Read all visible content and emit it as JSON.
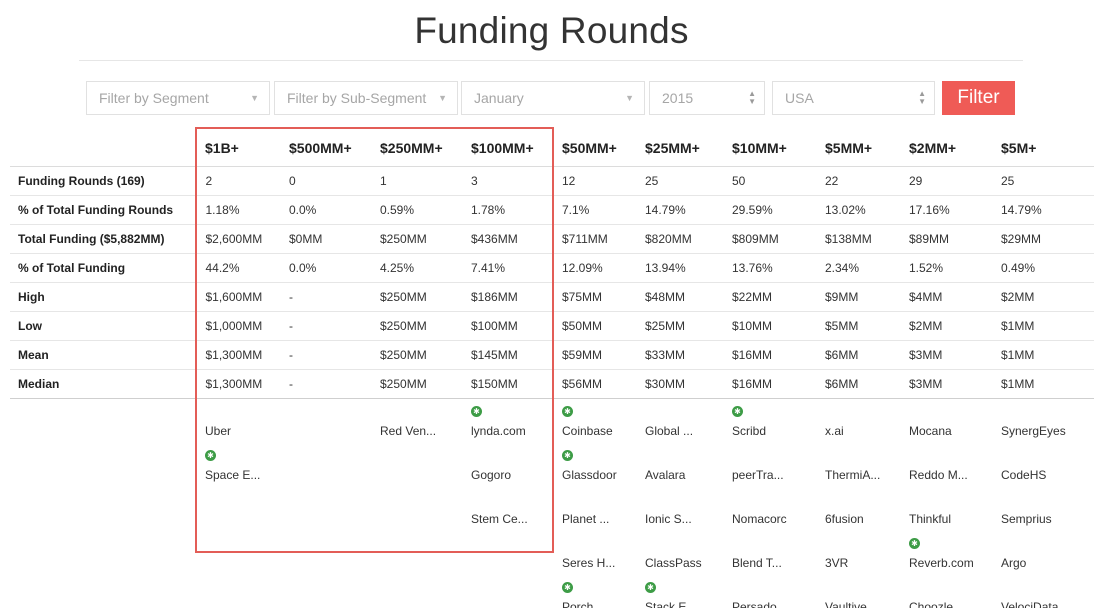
{
  "page": {
    "title": "Funding Rounds"
  },
  "filters": {
    "segment_placeholder": "Filter by Segment",
    "subsegment_placeholder": "Filter by Sub-Segment",
    "month_value": "January",
    "year_value": "2015",
    "country_value": "USA",
    "button_label": "Filter",
    "button_color": "#ef5b56"
  },
  "highlight_color": "#e35d57",
  "table": {
    "columns": [
      "$1B+",
      "$500MM+",
      "$250MM+",
      "$100MM+",
      "$50MM+",
      "$25MM+",
      "$10MM+",
      "$5MM+",
      "$2MM+",
      "$5M+"
    ],
    "rows": [
      {
        "label": "Funding Rounds (169)",
        "values": [
          "2",
          "0",
          "1",
          "3",
          "12",
          "25",
          "50",
          "22",
          "29",
          "25"
        ]
      },
      {
        "label": "% of Total Funding Rounds",
        "values": [
          "1.18%",
          "0.0%",
          "0.59%",
          "1.78%",
          "7.1%",
          "14.79%",
          "29.59%",
          "13.02%",
          "17.16%",
          "14.79%"
        ]
      },
      {
        "label": "Total Funding ($5,882MM)",
        "values": [
          "$2,600MM",
          "$0MM",
          "$250MM",
          "$436MM",
          "$711MM",
          "$820MM",
          "$809MM",
          "$138MM",
          "$89MM",
          "$29MM"
        ]
      },
      {
        "label": "% of Total Funding",
        "values": [
          "44.2%",
          "0.0%",
          "4.25%",
          "7.41%",
          "12.09%",
          "13.94%",
          "13.76%",
          "2.34%",
          "1.52%",
          "0.49%"
        ]
      },
      {
        "label": "High",
        "values": [
          "$1,600MM",
          "-",
          "$250MM",
          "$186MM",
          "$75MM",
          "$48MM",
          "$22MM",
          "$9MM",
          "$4MM",
          "$2MM"
        ]
      },
      {
        "label": "Low",
        "values": [
          "$1,000MM",
          "-",
          "$250MM",
          "$100MM",
          "$50MM",
          "$25MM",
          "$10MM",
          "$5MM",
          "$2MM",
          "$1MM"
        ]
      },
      {
        "label": "Mean",
        "values": [
          "$1,300MM",
          "-",
          "$250MM",
          "$145MM",
          "$59MM",
          "$33MM",
          "$16MM",
          "$6MM",
          "$3MM",
          "$1MM"
        ]
      },
      {
        "label": "Median",
        "values": [
          "$1,300MM",
          "-",
          "$250MM",
          "$150MM",
          "$56MM",
          "$30MM",
          "$16MM",
          "$6MM",
          "$3MM",
          "$1MM"
        ]
      }
    ]
  },
  "companies": [
    [
      {
        "name": "Uber",
        "star": false
      },
      {
        "name": "Space E...",
        "star": true
      }
    ],
    [],
    [
      {
        "name": "Red Ven...",
        "star": false
      }
    ],
    [
      {
        "name": "lynda.com",
        "star": true
      },
      {
        "name": "Gogoro",
        "star": false
      },
      {
        "name": "Stem Ce...",
        "star": false
      }
    ],
    [
      {
        "name": "Coinbase",
        "star": true
      },
      {
        "name": "Glassdoor",
        "star": true
      },
      {
        "name": "Planet ...",
        "star": false
      },
      {
        "name": "Seres H...",
        "star": false
      },
      {
        "name": "Porch",
        "star": true
      }
    ],
    [
      {
        "name": "Global ...",
        "star": false
      },
      {
        "name": "Avalara",
        "star": false
      },
      {
        "name": "Ionic S...",
        "star": false
      },
      {
        "name": "ClassPass",
        "star": false
      },
      {
        "name": "Stack E...",
        "star": true
      }
    ],
    [
      {
        "name": "Scribd",
        "star": true
      },
      {
        "name": "peerTra...",
        "star": false
      },
      {
        "name": "Nomacorc",
        "star": false
      },
      {
        "name": "Blend T...",
        "star": false
      },
      {
        "name": "Persado",
        "star": false
      }
    ],
    [
      {
        "name": "x.ai",
        "star": false
      },
      {
        "name": "ThermiA...",
        "star": false
      },
      {
        "name": "6fusion",
        "star": false
      },
      {
        "name": "3VR",
        "star": false
      },
      {
        "name": "Vaultive",
        "star": false
      }
    ],
    [
      {
        "name": "Mocana",
        "star": false
      },
      {
        "name": "Reddo M...",
        "star": false
      },
      {
        "name": "Thinkful",
        "star": false
      },
      {
        "name": "Reverb.com",
        "star": true
      },
      {
        "name": "Choozle",
        "star": false
      }
    ],
    [
      {
        "name": "SynergEyes",
        "star": false
      },
      {
        "name": "CodeHS",
        "star": false
      },
      {
        "name": "Semprius",
        "star": false
      },
      {
        "name": "Argo",
        "star": false
      },
      {
        "name": "VelociData",
        "star": false
      }
    ]
  ]
}
